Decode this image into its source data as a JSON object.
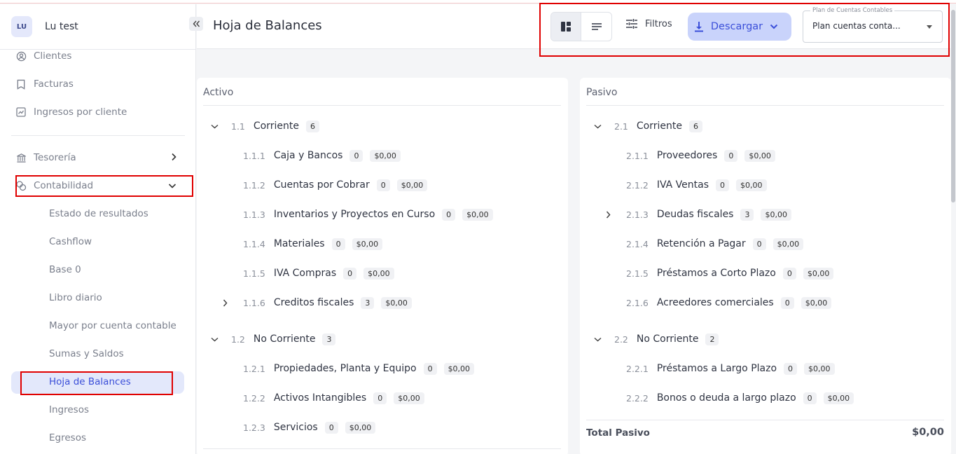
{
  "user": {
    "initials": "LU",
    "name": "Lu test"
  },
  "sidebar": {
    "top_items": [
      {
        "label": "Clientes",
        "icon": "user-circle-icon"
      },
      {
        "label": "Facturas",
        "icon": "bookmark-icon"
      },
      {
        "label": "Ingresos por cliente",
        "icon": "chart-icon"
      }
    ],
    "tesoreria": {
      "label": "Tesorería",
      "icon": "bank-icon"
    },
    "contabilidad": {
      "label": "Contabilidad",
      "icon": "coins-icon"
    },
    "sub_items": [
      "Estado de resultados",
      "Cashflow",
      "Base 0",
      "Libro diario",
      "Mayor por cuenta contable",
      "Sumas y Saldos",
      "Hoja de Balances",
      "Ingresos",
      "Egresos"
    ],
    "active": "Hoja de Balances"
  },
  "header": {
    "title": "Hoja de Balances",
    "filters_label": "Filtros",
    "download_label": "Descargar",
    "select_label": "Plan de Cuentas Contables",
    "select_value": "Plan cuentas conta..."
  },
  "activo": {
    "title": "Activo",
    "groups": [
      {
        "code": "1.1",
        "name": "Corriente",
        "count": "6",
        "items": [
          {
            "code": "1.1.1",
            "name": "Caja y Bancos",
            "count": "0",
            "amount": "$0,00",
            "expandable": false
          },
          {
            "code": "1.1.2",
            "name": "Cuentas por Cobrar",
            "count": "0",
            "amount": "$0,00",
            "expandable": false
          },
          {
            "code": "1.1.3",
            "name": "Inventarios y Proyectos en Curso",
            "count": "0",
            "amount": "$0,00",
            "expandable": false
          },
          {
            "code": "1.1.4",
            "name": "Materiales",
            "count": "0",
            "amount": "$0,00",
            "expandable": false
          },
          {
            "code": "1.1.5",
            "name": "IVA Compras",
            "count": "0",
            "amount": "$0,00",
            "expandable": false
          },
          {
            "code": "1.1.6",
            "name": "Creditos fiscales",
            "count": "3",
            "amount": "$0,00",
            "expandable": true
          }
        ]
      },
      {
        "code": "1.2",
        "name": "No Corriente",
        "count": "3",
        "items": [
          {
            "code": "1.2.1",
            "name": "Propiedades, Planta y Equipo",
            "count": "0",
            "amount": "$0,00",
            "expandable": false
          },
          {
            "code": "1.2.2",
            "name": "Activos Intangibles",
            "count": "0",
            "amount": "$0,00",
            "expandable": false
          },
          {
            "code": "1.2.3",
            "name": "Servicios",
            "count": "0",
            "amount": "$0,00",
            "expandable": false
          }
        ]
      }
    ]
  },
  "pasivo": {
    "title": "Pasivo",
    "groups": [
      {
        "code": "2.1",
        "name": "Corriente",
        "count": "6",
        "items": [
          {
            "code": "2.1.1",
            "name": "Proveedores",
            "count": "0",
            "amount": "$0,00",
            "expandable": false
          },
          {
            "code": "2.1.2",
            "name": "IVA Ventas",
            "count": "0",
            "amount": "$0,00",
            "expandable": false
          },
          {
            "code": "2.1.3",
            "name": "Deudas fiscales",
            "count": "3",
            "amount": "$0,00",
            "expandable": true
          },
          {
            "code": "2.1.4",
            "name": "Retención a Pagar",
            "count": "0",
            "amount": "$0,00",
            "expandable": false
          },
          {
            "code": "2.1.5",
            "name": "Préstamos a Corto Plazo",
            "count": "0",
            "amount": "$0,00",
            "expandable": false
          },
          {
            "code": "2.1.6",
            "name": "Acreedores comerciales",
            "count": "0",
            "amount": "$0,00",
            "expandable": false
          }
        ]
      },
      {
        "code": "2.2",
        "name": "No Corriente",
        "count": "2",
        "items": [
          {
            "code": "2.2.1",
            "name": "Préstamos a Largo Plazo",
            "count": "0",
            "amount": "$0,00",
            "expandable": false
          },
          {
            "code": "2.2.2",
            "name": "Bonos o deuda a largo plazo",
            "count": "0",
            "amount": "$0,00",
            "expandable": false
          }
        ]
      }
    ],
    "total_label": "Total Pasivo",
    "total_value": "$0,00"
  },
  "colors": {
    "accent": "#3b4fd9",
    "accent_light": "#c9d3fb",
    "highlight": "#e00000"
  }
}
